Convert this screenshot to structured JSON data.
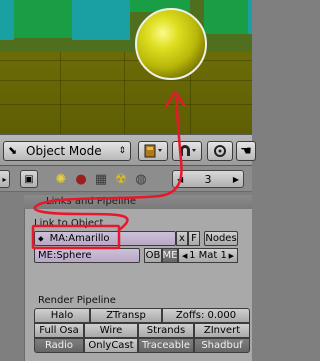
{
  "header": {
    "mode_label": "Object Mode",
    "mode_icon": "object-mode-icon"
  },
  "buttons_window": {
    "frame_value": "3"
  },
  "panel": {
    "tab_title": "Links and Pipeline",
    "link_section": {
      "title": "Link to Object",
      "material_field": "MA:Amarillo",
      "x_label": "x",
      "f_label": "F",
      "nodes_label": "Nodes",
      "mesh_field": "ME:Sphere",
      "ob_label": "OB",
      "me_label": "ME",
      "mat_index": "1 Mat 1"
    },
    "render_pipeline": {
      "title": "Render Pipeline",
      "row1": [
        "Halo",
        "ZTransp",
        "Zoffs: 0.000"
      ],
      "row2": [
        "Full Osa",
        "Wire",
        "Strands",
        "ZInvert"
      ],
      "row3": [
        "Radio",
        "OnlyCast",
        "Traceable",
        "Shadbuf"
      ]
    }
  },
  "colors": {
    "annotation_red": "#e8172b",
    "sphere_yellow": "#d4d41a",
    "panel_bg": "#a9a9a9"
  }
}
